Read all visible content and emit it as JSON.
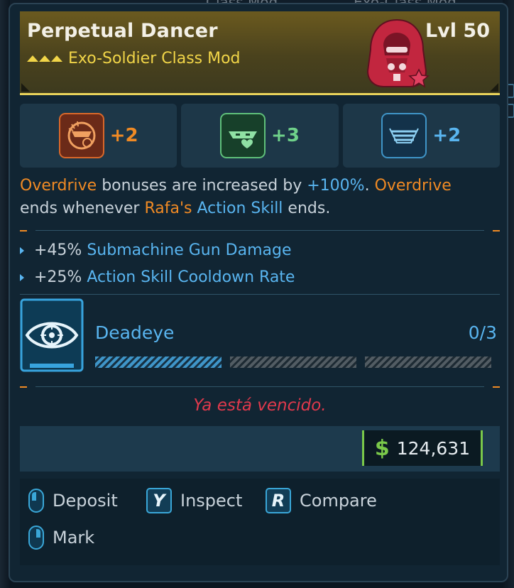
{
  "background": {
    "top_fragments": [
      "Class Mod",
      "Exo-Class Mod"
    ]
  },
  "item": {
    "name": "Perpetual Dancer",
    "level": "Lvl 50",
    "type": "Exo-Soldier Class Mod",
    "rarity_color": "#f1d548",
    "portrait_icon": "exo-soldier-hood-icon"
  },
  "skill_boosts": [
    {
      "icon": "gunslinger-skill-icon",
      "value": "+2",
      "color": "#f08a24"
    },
    {
      "icon": "mask-heart-skill-icon",
      "value": "+3",
      "color": "#6fd18a"
    },
    {
      "icon": "stacked-weapons-skill-icon",
      "value": "+2",
      "color": "#59b5f0"
    }
  ],
  "description": {
    "t1": "Overdrive",
    "t2": " bonuses are increased by ",
    "t3": "+100%",
    "t4": ". ",
    "t5": "Overdrive",
    "t6": "ends whenever ",
    "t7": "Rafa's",
    "t8": " ",
    "t9": "Action Skill",
    "t10": " ends."
  },
  "bonuses": [
    {
      "amount": "+45%",
      "stat": "Submachine Gun Damage"
    },
    {
      "amount": "+25%",
      "stat": "Action Skill Cooldown Rate"
    }
  ],
  "challenge": {
    "icon": "eye-target-icon",
    "name": "Deadeye",
    "progress_text": "0/3",
    "segments_filled": 1,
    "segments_total": 3
  },
  "status": "Ya está vencido.",
  "price": {
    "symbol": "$",
    "amount": "124,631",
    "color": "#7ac94a"
  },
  "actions": [
    {
      "input": "mouse-left",
      "label": "Deposit"
    },
    {
      "input": "Y",
      "label": "Inspect"
    },
    {
      "input": "R",
      "label": "Compare"
    },
    {
      "input": "mouse-right",
      "label": "Mark"
    }
  ],
  "colors": {
    "accent_orange": "#f08a24",
    "accent_blue": "#59b5f0",
    "danger": "#e0394c"
  }
}
